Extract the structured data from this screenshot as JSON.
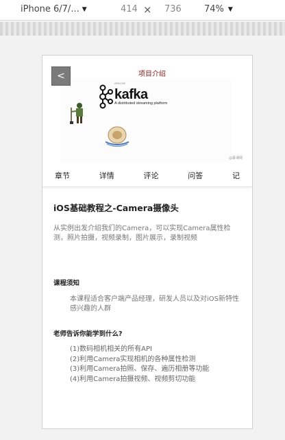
{
  "devtools": {
    "device_label": "iPhone 6/7/...",
    "width": "414",
    "times": "×",
    "height": "736",
    "zoom": "74%",
    "caret": "▼"
  },
  "header": {
    "back_label": "<",
    "title": "项目介绍"
  },
  "banner": {
    "brand_small": "APACHE",
    "brand_word": "kafka",
    "tagline": "A distributed streaming platform",
    "corner_text": "@慕课网"
  },
  "tabs": [
    {
      "label": "章节"
    },
    {
      "label": "详情"
    },
    {
      "label": "评论"
    },
    {
      "label": "问答"
    },
    {
      "label": "记"
    }
  ],
  "course": {
    "title": "iOS基础教程之-Camera摄像头",
    "description": "从实例出发介绍我们的Camera，可以实现Camera属性检测，照片拍摄，视频录制，图片展示，录制视频"
  },
  "notice": {
    "heading": "课程须知",
    "body": "本课程适合客户端产品经理，研发人员以及对iOS新特性感兴趣的人群"
  },
  "learn": {
    "heading": "老师告诉你能学到什么?",
    "items": [
      "(1)数码相机相关的所有API",
      "(2)利用Camera实现相机的各种属性检测",
      "(3)利用Camera拍照、保存、遍历相册等功能",
      "(4)利用Camera拍摄视频、视频剪切功能"
    ]
  }
}
